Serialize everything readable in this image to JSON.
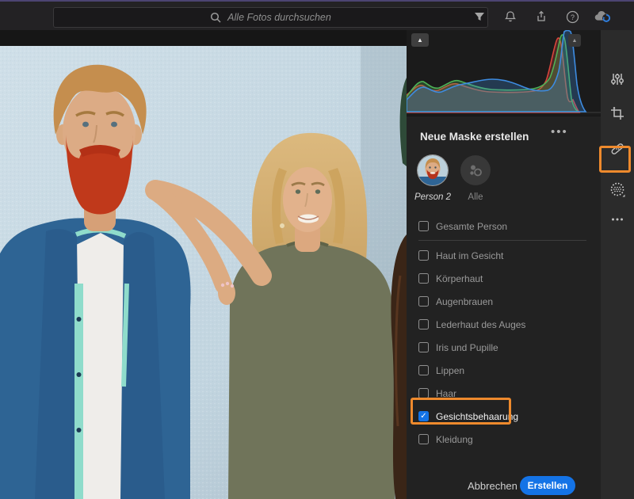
{
  "topbar": {
    "search_placeholder": "Alle Fotos durchsuchen",
    "icons": [
      "search-icon",
      "filter-icon",
      "bell-icon",
      "share-icon",
      "help-icon",
      "cloud-sync-icon"
    ]
  },
  "histogram": {
    "channels": [
      "red",
      "green",
      "blue"
    ],
    "colors": {
      "red": "#d8453c",
      "green": "#4fb257",
      "blue": "#3d8be0"
    },
    "collapse_left": "▲",
    "collapse_right": "▲"
  },
  "mask_panel": {
    "title": "Neue Maske erstellen",
    "menu_icon": "•••",
    "people": [
      {
        "label": "Person 2",
        "selected": true
      },
      {
        "label": "Alle",
        "selected": false
      }
    ],
    "options": [
      {
        "label": "Gesamte Person",
        "checked": false,
        "divider_after": true
      },
      {
        "label": "Haut im Gesicht",
        "checked": false
      },
      {
        "label": "Körperhaut",
        "checked": false
      },
      {
        "label": "Augenbrauen",
        "checked": false
      },
      {
        "label": "Lederhaut des Auges",
        "checked": false
      },
      {
        "label": "Iris und Pupille",
        "checked": false
      },
      {
        "label": "Lippen",
        "checked": false
      },
      {
        "label": "Haar",
        "checked": false
      },
      {
        "label": "Gesichtsbehaarung",
        "checked": true,
        "highlighted": true
      },
      {
        "label": "Kleidung",
        "checked": false
      }
    ],
    "cancel_label": "Abbrechen",
    "create_label": "Erstellen",
    "check_glyph": "✓"
  },
  "toolrail": {
    "icons": [
      "edit-sliders-icon",
      "crop-icon",
      "healing-brush-icon",
      "masking-icon",
      "more-icon"
    ],
    "active_tool": "masking"
  },
  "colors": {
    "accent_blue": "#1473e6",
    "annotation_orange": "#ee8a2d",
    "panel_bg": "#222222",
    "topbar_bg": "#232224",
    "toolrail_bg": "#2b2b2b"
  }
}
